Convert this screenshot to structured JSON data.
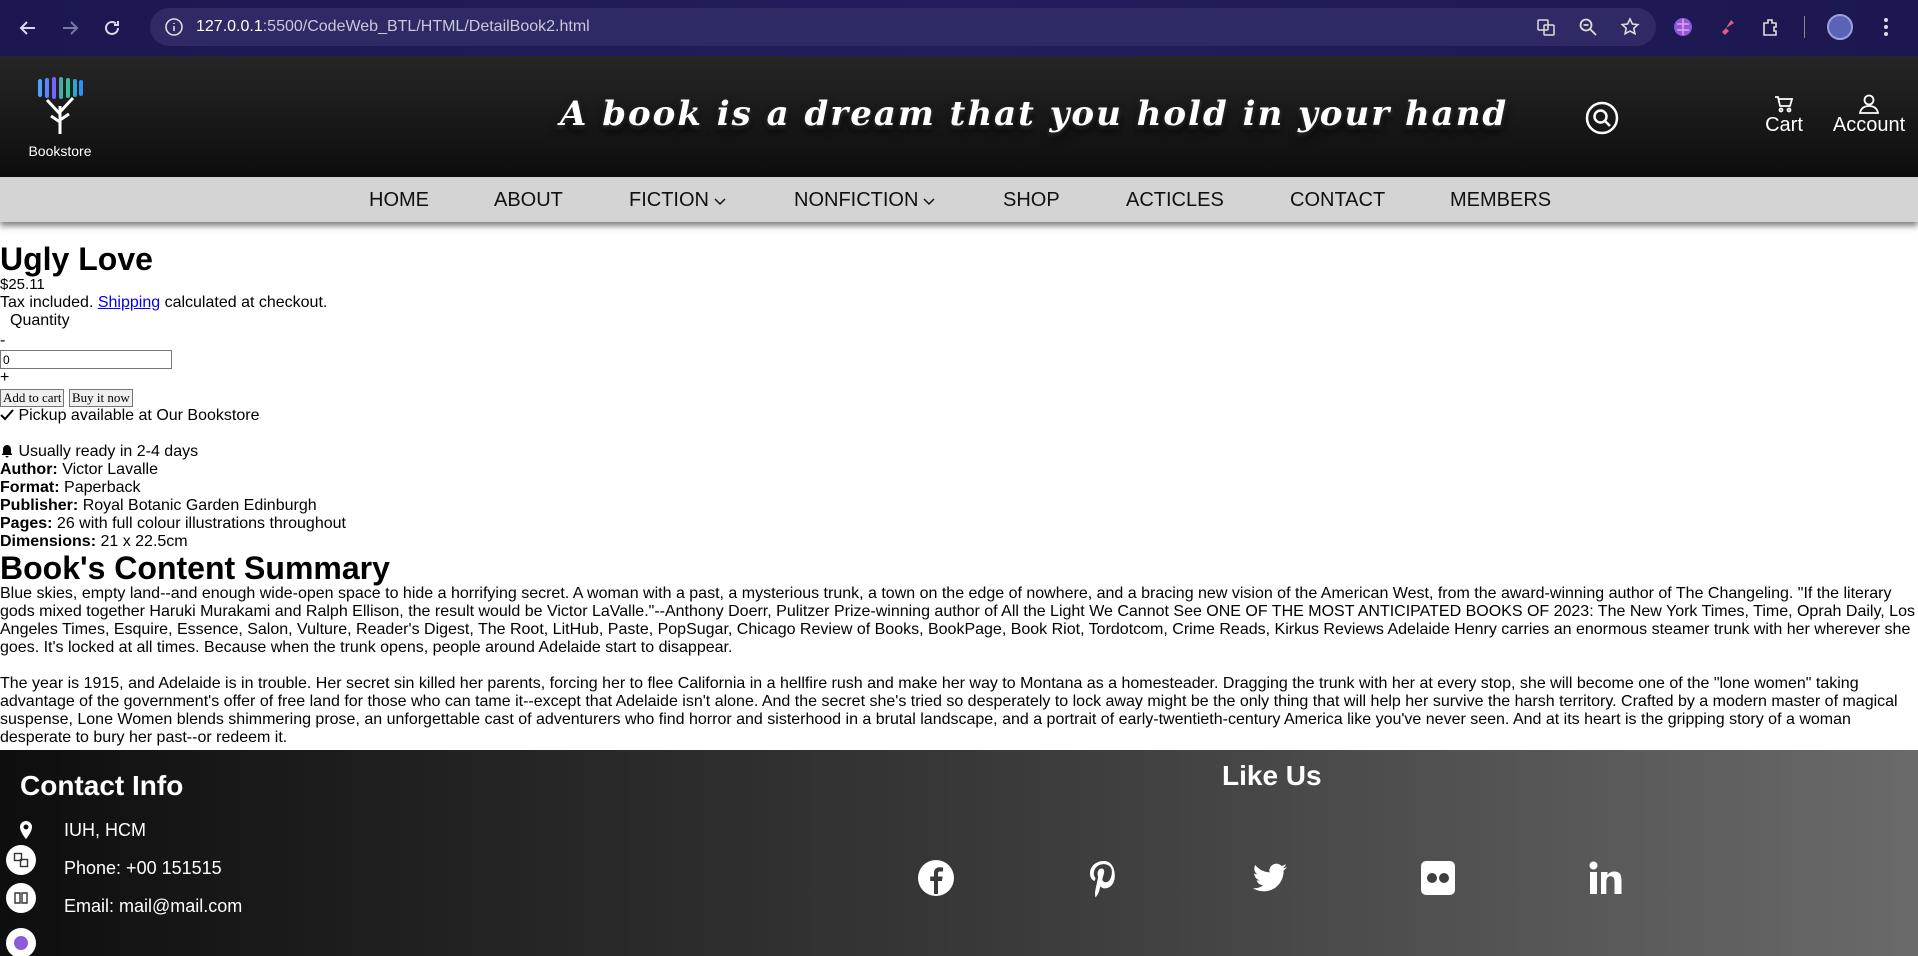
{
  "browser": {
    "url_host": "127.0.0.1",
    "url_rest": ":5500/CodeWeb_BTL/HTML/DetailBook2.html"
  },
  "header": {
    "logo_text": "Bookstore",
    "slogan": "A book is a dream that you hold in your hand",
    "cart_label": "Cart",
    "account_label": "Account"
  },
  "menu": {
    "items": [
      "HOME",
      "ABOUT",
      "FICTION",
      "NONFICTION",
      "SHOP",
      "ACTICLES",
      "CONTACT",
      "MEMBERS"
    ]
  },
  "product": {
    "title": "Ugly Love",
    "price": "$25.11",
    "tax_prefix": "Tax included.",
    "shipping_link": "Shipping",
    "tax_suffix": "calculated at checkout.",
    "quantity_label": "Quantity",
    "minus": "-",
    "quantity_value": "0",
    "plus": "+",
    "add_to_cart": "Add to cart",
    "buy_now": "Buy it now",
    "pickup": "Pickup available at Our Bookstore",
    "ready": "Usually ready in 2-4 days",
    "specs": {
      "author_label": "Author:",
      "author": "Victor Lavalle",
      "format_label": "Format:",
      "format": "Paperback",
      "publisher_label": "Publisher:",
      "publisher": "Royal Botanic Garden Edinburgh",
      "pages_label": "Pages:",
      "pages": "26 with full colour illustrations throughout",
      "dimensions_label": "Dimensions:",
      "dimensions": "21 x 22.5cm"
    },
    "summary_title": "Book's Content Summary",
    "summary_p1": "Blue skies, empty land--and enough wide-open space to hide a horrifying secret. A woman with a past, a mysterious trunk, a town on the edge of nowhere, and a bracing new vision of the American West, from the award-winning author of The Changeling. \"If the literary gods mixed together Haruki Murakami and Ralph Ellison, the result would be Victor LaValle.\"--Anthony Doerr, Pulitzer Prize-winning author of All the Light We Cannot See ONE OF THE MOST ANTICIPATED BOOKS OF 2023: The New York Times, Time, Oprah Daily, Los Angeles Times, Esquire, Essence, Salon, Vulture, Reader's Digest, The Root, LitHub, Paste, PopSugar, Chicago Review of Books, BookPage, Book Riot, Tordotcom, Crime Reads, Kirkus Reviews Adelaide Henry carries an enormous steamer trunk with her wherever she goes. It's locked at all times. Because when the trunk opens, people around Adelaide start to disappear.",
    "summary_p2": "The year is 1915, and Adelaide is in trouble. Her secret sin killed her parents, forcing her to flee California in a hellfire rush and make her way to Montana as a homesteader. Dragging the trunk with her at every stop, she will become one of the \"lone women\" taking advantage of the government's offer of free land for those who can tame it--except that Adelaide isn't alone. And the secret she's tried so desperately to lock away might be the only thing that will help her survive the harsh territory. Crafted by a modern master of magical suspense, Lone Women blends shimmering prose, an unforgettable cast of adventurers who find horror and sisterhood in a brutal landscape, and a portrait of early-twentieth-century America like you've never seen. And at its heart is the gripping story of a woman desperate to bury her past--or redeem it."
  },
  "footer": {
    "contact_title": "Contact Info",
    "address": "IUH, HCM",
    "phone": "Phone: +00 151515",
    "email": "Email: mail@mail.com",
    "like_title": "Like Us",
    "socials": [
      "facebook-icon",
      "pinterest-icon",
      "twitter-icon",
      "flickr-icon",
      "linkedin-icon"
    ]
  }
}
